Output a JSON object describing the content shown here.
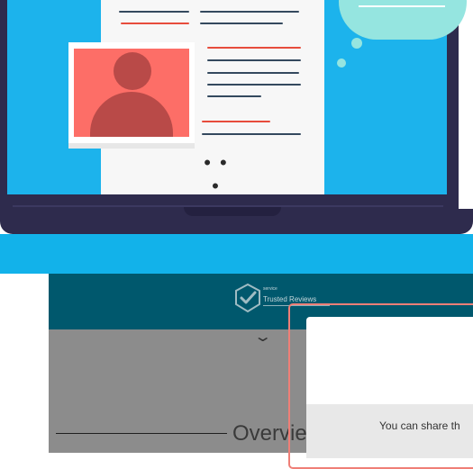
{
  "illustration": {
    "ellipsis": "• • •",
    "colors": {
      "laptop": "#2e2b4d",
      "screen": "#1cb3ec",
      "document": "#f7f7f7",
      "photo": "#fd6e67",
      "avatar": "#b94a48",
      "cloud": "#95e5e0",
      "line_dark": "#34495e",
      "line_red": "#e74c3c"
    }
  },
  "mockup": {
    "header": {
      "brand_small": "service",
      "brand_name": "Trusted Reviews",
      "color": "#00586d"
    },
    "expand_icon": "chevron-down-icon",
    "overview_label": "Overvie",
    "modal": {
      "share_text": "You can share th"
    }
  }
}
